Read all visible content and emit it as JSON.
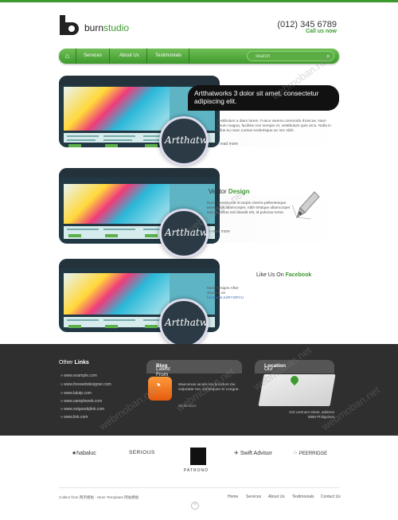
{
  "brand": {
    "name_prefix": "burn",
    "name_suffix": "studio"
  },
  "header": {
    "phone": "(012) 345 6789",
    "call_label": "Call us now"
  },
  "nav": {
    "home_icon": "home-icon",
    "items": [
      {
        "label": "Services"
      },
      {
        "label": "About Us"
      },
      {
        "label": "Testimonials"
      }
    ],
    "search_placeholder": "search"
  },
  "slides": [
    {
      "preview_word": "Artthatw",
      "headline": "Artthatworks 3 dolor sit amet, consectetur adipiscing elit.",
      "text": "Vestibulum a diam lorem. Fusce viverra commodo rhoncus. Nam ipsum magna, facilisis non semper et, vestibulum quis arcu. Nulla in tellus eu nunc cursus scelerisque ac nec nibh.",
      "read_more": "» read more"
    },
    {
      "preview_word": "Artthatw",
      "title_prefix": "Vector",
      "title_highlight": "Design",
      "text": "Nunc viverra erat et turpis viverra pellentesque. Maecenas ullamcorper, nibh tristique ullamcorper lacinia, tellus nisi blandit elit, id pulvinar tortor.",
      "read_more": "» read more"
    },
    {
      "preview_word": "Artthatw",
      "title_prefix": "Like Us On",
      "title_highlight": "Facebook",
      "text": "Neal Resigns After Student on",
      "link": "facebook.to/RYSRYL!"
    }
  ],
  "footer": {
    "other_links_title_prefix": "Other",
    "other_links_title_highlight": "Links",
    "links": [
      "» www.example.com",
      "» www.freewebdesigner.com",
      "» www.lalutp.com",
      "» www.sampleweb.com",
      "» www.sotgoodqlink.com",
      "» www.link.com"
    ],
    "blog_title_prefix": "Latest From The",
    "blog_title_highlight": "Blog",
    "blog_text": "Maecenas iaculis leo tincidunt dui vulputate nec consequat mi congue.",
    "blog_date": "05.10.2012",
    "location_title_prefix": "Our",
    "location_title_highlight": "Location",
    "address": "123 Lemnum street, address\n8880 Philippines"
  },
  "partners": [
    "habaluc",
    "SERIOUS",
    "PATRONO",
    "Swift Advisor",
    "PEERRIDGE"
  ],
  "bottom": {
    "copyright": "Collect from 网页模板 - More Templates 网站模板",
    "links": [
      "Home",
      "Services",
      "About Us",
      "Testimonials",
      "Contact Us"
    ],
    "to_top": "^"
  },
  "watermark": "webmoban.net",
  "colors": {
    "accent": "#3d9a2f",
    "dark": "#2f2f2f",
    "banner": "#111111"
  }
}
